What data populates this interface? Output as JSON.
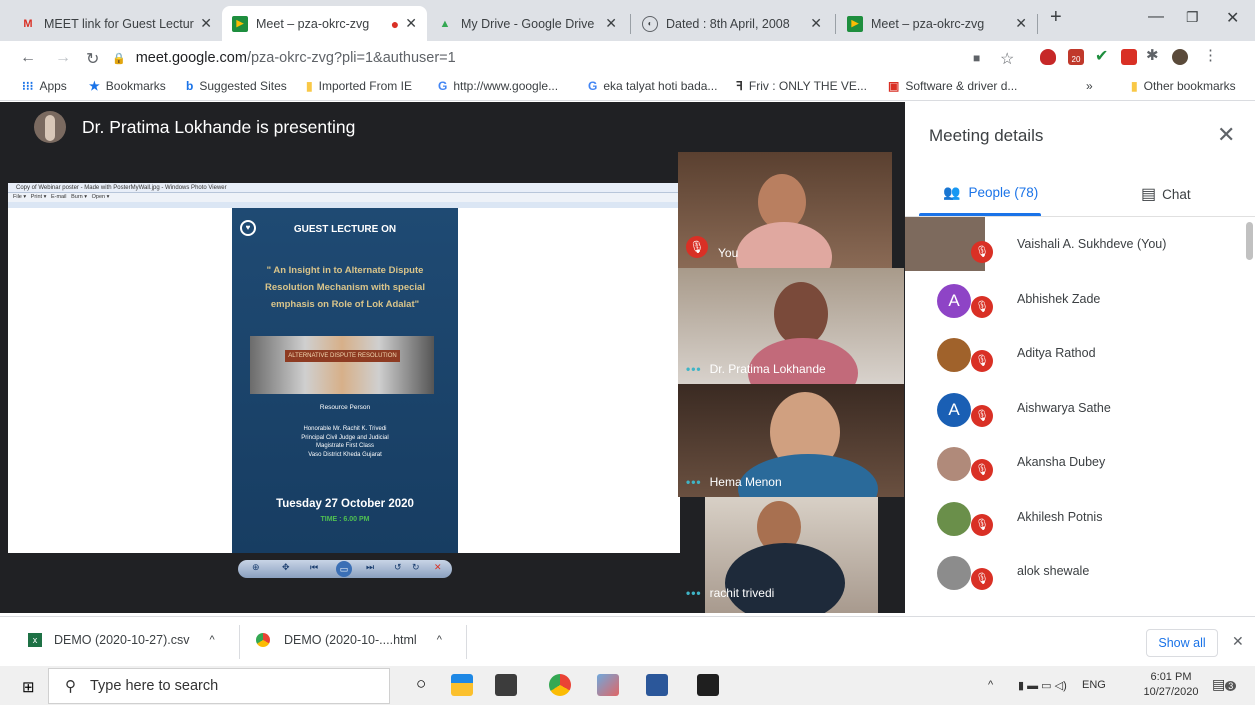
{
  "tabs": [
    {
      "title": "MEET link for Guest Lecture",
      "icon": "gmail-icon",
      "active": false
    },
    {
      "title": "Meet – pza-okrc-zvg",
      "icon": "meet-icon",
      "active": true
    },
    {
      "title": "My Drive - Google Drive",
      "icon": "drive-icon",
      "active": false
    },
    {
      "title": "Dated : 8th April, 2008",
      "icon": "globe-icon",
      "active": false
    },
    {
      "title": "Meet – pza-okrc-zvg",
      "icon": "meet-icon",
      "active": false
    }
  ],
  "address": {
    "host": "meet.google.com",
    "path": "/pza-okrc-zvg?pli=1&authuser=1"
  },
  "extension_badge": "20",
  "bookmarks": [
    {
      "label": "Apps",
      "icon": "apps-grid-icon"
    },
    {
      "label": "Bookmarks",
      "icon": "star-icon"
    },
    {
      "label": "Suggested Sites",
      "icon": "bing-icon"
    },
    {
      "label": "Imported From IE",
      "icon": "folder-icon"
    },
    {
      "label": "http://www.google...",
      "icon": "google-icon"
    },
    {
      "label": "eka talyat hoti bada...",
      "icon": "google-icon"
    },
    {
      "label": "Friv : ONLY THE VE...",
      "icon": "friv-icon"
    },
    {
      "label": "Software & driver d...",
      "icon": "hp-icon"
    }
  ],
  "bookmarks_more": "»",
  "other_bookmarks": "Other bookmarks",
  "presenter_banner": "Dr. Pratima Lokhande is presenting",
  "viewer": {
    "title": "Copy of Webinar poster - Made with PosterMyWall.jpg - Windows Photo Viewer",
    "menu": [
      "File",
      "Print",
      "E-mail",
      "Burn",
      "Open"
    ]
  },
  "poster": {
    "heading": "GUEST LECTURE ON",
    "topic": "\" An Insight in to Alternate Dispute Resolution Mechanism with special emphasis on Role of Lok Adalat\"",
    "image_caption": "ALTERNATIVE DISPUTE RESOLUTION",
    "resource_label": "Resource Person",
    "resource_lines": [
      "Honorable Mr. Rachit K. Trivedi",
      "Principal Civil Judge and Judicial",
      "Magistrate First Class",
      "Vaso District Kheda Gujarat"
    ],
    "date": "Tuesday 27 October 2020",
    "time": "TIME : 6.00 PM"
  },
  "tiles": [
    {
      "name": "You"
    },
    {
      "name": "Dr. Pratima Lokhande"
    },
    {
      "name": "Hema Menon"
    },
    {
      "name": "rachit trivedi"
    }
  ],
  "panel": {
    "title": "Meeting details",
    "people_tab": "People (78)",
    "chat_tab": "Chat",
    "people": [
      {
        "name": "Vaishali A. Sukhdeve (You)",
        "avatar": "photo",
        "color": "#7d6a5d"
      },
      {
        "name": "Abhishek Zade",
        "avatar": "A",
        "color": "#8e44c6"
      },
      {
        "name": "Aditya Rathod",
        "avatar": "photo",
        "color": "#a0622b"
      },
      {
        "name": "Aishwarya Sathe",
        "avatar": "A",
        "color": "#1a5fb4"
      },
      {
        "name": "Akansha Dubey",
        "avatar": "photo",
        "color": "#b08a7a"
      },
      {
        "name": "Akhilesh Potnis",
        "avatar": "photo",
        "color": "#6a8f4a"
      },
      {
        "name": "alok shewale",
        "avatar": "photo",
        "color": "#8c8c8c"
      }
    ]
  },
  "downloads": [
    {
      "name": "DEMO (2020-10-27).csv",
      "icon": "excel-icon"
    },
    {
      "name": "DEMO (2020-10-....html",
      "icon": "chrome-icon"
    }
  ],
  "show_all": "Show all",
  "taskbar": {
    "search_placeholder": "Type here to search",
    "lang": "ENG",
    "time": "6:01 PM",
    "date": "10/27/2020",
    "notifications": "3"
  }
}
